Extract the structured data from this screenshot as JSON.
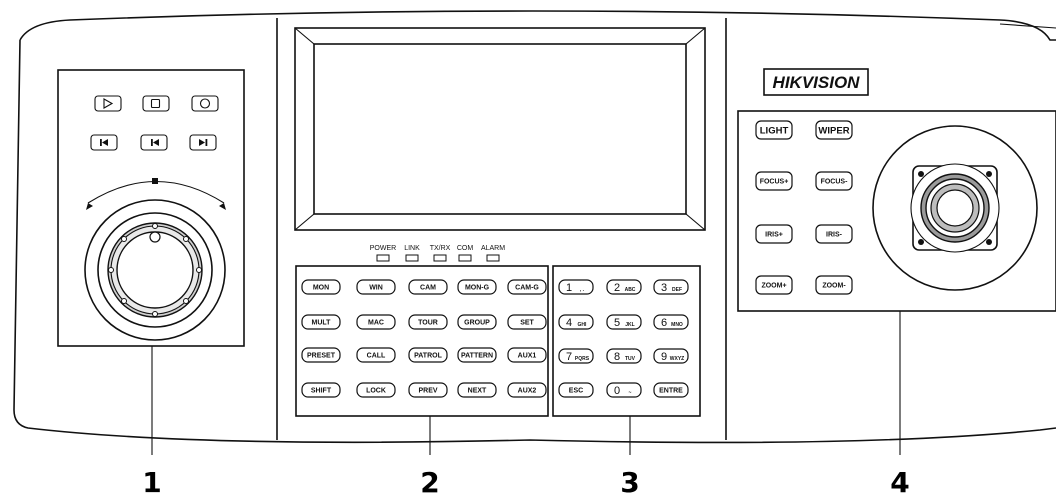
{
  "brand": "HIKVISION",
  "indicators": [
    "POWER",
    "LINK",
    "TX/RX",
    "COM",
    "ALARM"
  ],
  "function_keys": [
    [
      "MON",
      "WIN",
      "CAM",
      "MON-G",
      "CAM-G"
    ],
    [
      "MULT",
      "MAC",
      "TOUR",
      "GROUP",
      "SET"
    ],
    [
      "PRESET",
      "CALL",
      "PATROL",
      "PATTERN",
      "AUX1"
    ],
    [
      "SHIFT",
      "LOCK",
      "PREV",
      "NEXT",
      "AUX2"
    ]
  ],
  "numeric_keys": [
    [
      {
        "main": "1",
        "sub": ", ."
      },
      {
        "main": "2",
        "sub": "ABC"
      },
      {
        "main": "3",
        "sub": "DEF"
      }
    ],
    [
      {
        "main": "4",
        "sub": "GHI"
      },
      {
        "main": "5",
        "sub": "JKL"
      },
      {
        "main": "6",
        "sub": "MNO"
      }
    ],
    [
      {
        "main": "7",
        "sub": "PQRS"
      },
      {
        "main": "8",
        "sub": "TUV"
      },
      {
        "main": "9",
        "sub": "WXYZ"
      }
    ],
    [
      {
        "main": "ESC",
        "sub": ""
      },
      {
        "main": "0",
        "sub": "~"
      },
      {
        "main": "ENTRE",
        "sub": ""
      }
    ]
  ],
  "ptz_keys": [
    [
      "LIGHT",
      "WIPER"
    ],
    [
      "FOCUS+",
      "FOCUS-"
    ],
    [
      "IRIS+",
      "IRIS-"
    ],
    [
      "ZOOM+",
      "ZOOM-"
    ]
  ],
  "callouts": [
    "1",
    "2",
    "3",
    "4"
  ]
}
